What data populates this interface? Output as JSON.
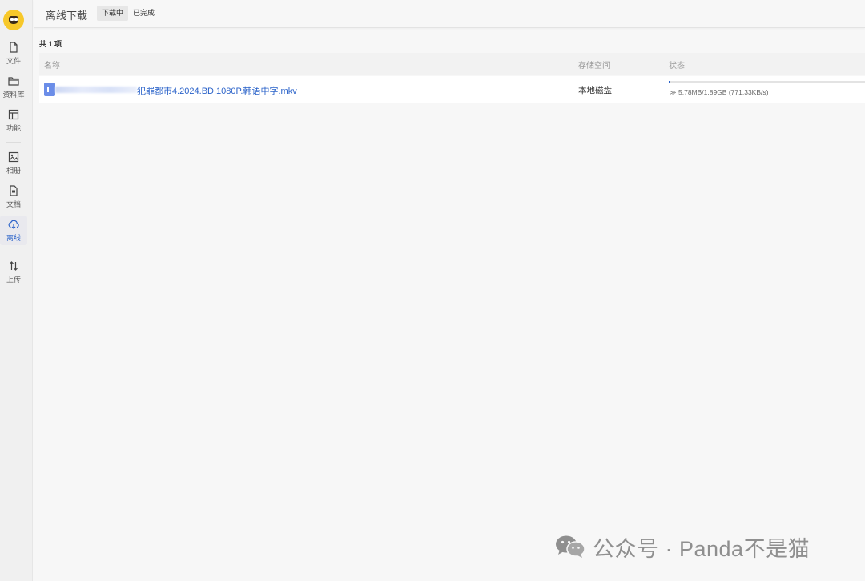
{
  "sidebar": {
    "items": [
      {
        "label": "文件",
        "icon": "file-icon"
      },
      {
        "label": "资料库",
        "icon": "folder-icon"
      },
      {
        "label": "功能",
        "icon": "layout-icon"
      },
      {
        "label": "相册",
        "icon": "image-icon"
      },
      {
        "label": "文档",
        "icon": "document-icon"
      },
      {
        "label": "离线",
        "icon": "cloud-download-icon",
        "active": true
      },
      {
        "label": "上传",
        "icon": "transfer-arrows-icon"
      }
    ]
  },
  "header": {
    "title": "离线下载",
    "tabs": [
      {
        "label": "下载中",
        "active": true
      },
      {
        "label": "已完成",
        "active": false
      }
    ]
  },
  "main": {
    "count": "共 1 项",
    "columns": [
      "名称",
      "存储空间",
      "状态"
    ],
    "rows": [
      {
        "name": "犯罪都市4.2024.BD.1080P.韩语中字.mkv",
        "storage": "本地磁盘",
        "progress_fraction": 0.003,
        "status": "5.78MB/1.89GB (771.33KB/s)",
        "status_icon": "pause-chevron-icon"
      }
    ]
  },
  "watermark": {
    "text": "公众号 · Panda不是猫",
    "icon": "wechat-icon"
  },
  "colors": {
    "accent": "#2a62c9",
    "background": "#f7f7f7",
    "sidebar": "#f0f0f0"
  }
}
